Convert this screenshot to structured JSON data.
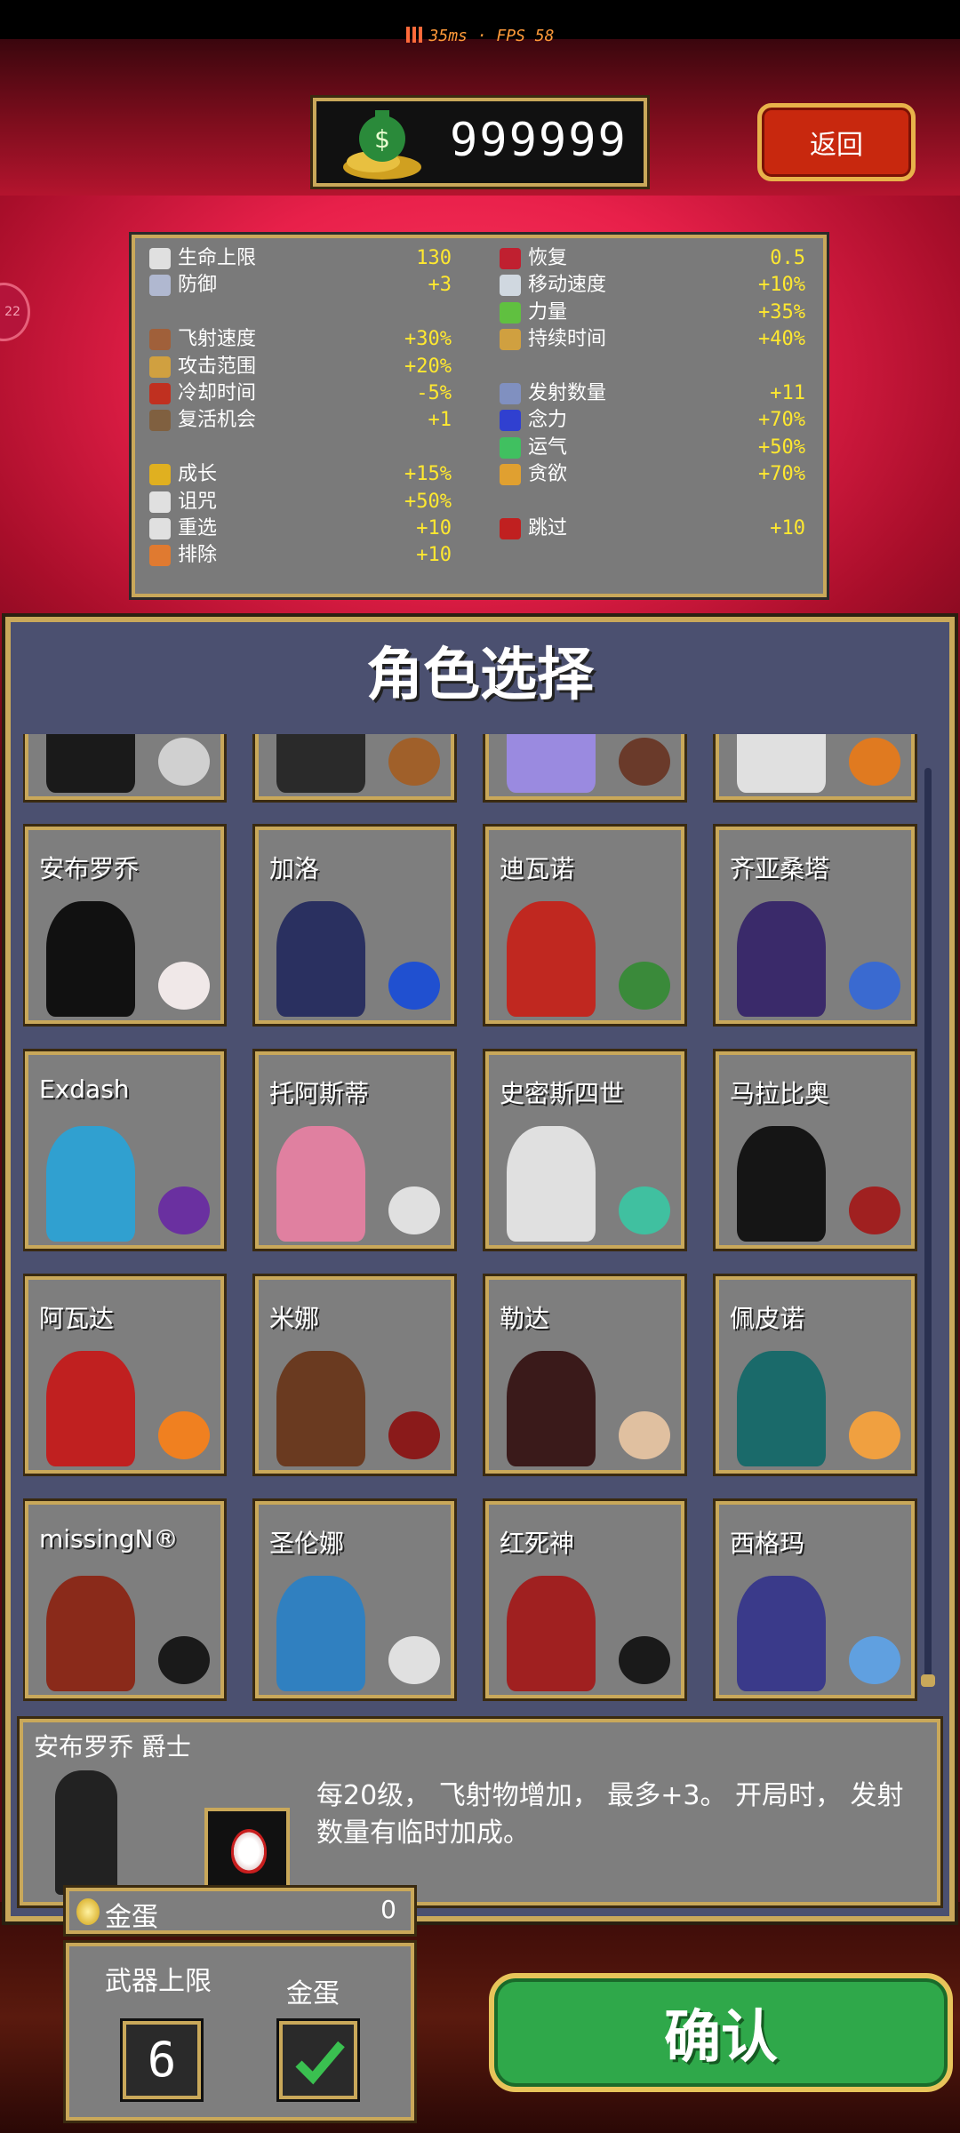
{
  "status": {
    "ping": "35ms",
    "fps": "FPS 58"
  },
  "header": {
    "coins": "999999",
    "back_label": "返回"
  },
  "side_badge": "22",
  "stats_left": [
    {
      "label": "生命上限",
      "value": "130",
      "icon_color": "#e0e0e0"
    },
    {
      "label": "防御",
      "value": "+3",
      "icon_color": "#b0b8d0"
    },
    {
      "label": "飞射速度",
      "value": "+30%",
      "icon_color": "#a0603a"
    },
    {
      "label": "攻击范围",
      "value": "+20%",
      "icon_color": "#d0a040"
    },
    {
      "label": "冷却时间",
      "value": "-5%",
      "icon_color": "#c03020"
    },
    {
      "label": "复活机会",
      "value": "+1",
      "icon_color": "#806040"
    },
    {
      "label": "成长",
      "value": "+15%",
      "icon_color": "#e0b020"
    },
    {
      "label": "诅咒",
      "value": "+50%",
      "icon_color": "#e0e0e0"
    },
    {
      "label": "重选",
      "value": "+10",
      "icon_color": "#e0e0e0"
    },
    {
      "label": "排除",
      "value": "+10",
      "icon_color": "#e07a30"
    }
  ],
  "stats_right": [
    {
      "label": "恢复",
      "value": "0.5",
      "icon_color": "#c02030"
    },
    {
      "label": "移动速度",
      "value": "+10%",
      "icon_color": "#d0d8e0"
    },
    {
      "label": "力量",
      "value": "+35%",
      "icon_color": "#60c040"
    },
    {
      "label": "持续时间",
      "value": "+40%",
      "icon_color": "#d0a040"
    },
    {
      "label": "发射数量",
      "value": "+11",
      "icon_color": "#8090c0"
    },
    {
      "label": "念力",
      "value": "+70%",
      "icon_color": "#3040d0"
    },
    {
      "label": "运气",
      "value": "+50%",
      "icon_color": "#40c060"
    },
    {
      "label": "贪欲",
      "value": "+70%",
      "icon_color": "#e0a030"
    },
    {
      "label": "跳过",
      "value": "+10",
      "icon_color": "#c02020"
    }
  ],
  "panel": {
    "title": "角色选择"
  },
  "characters": [
    {
      "name": "",
      "fig": "#1a1a1a",
      "item": "#d0d0d0"
    },
    {
      "name": "",
      "fig": "#2a2a2a",
      "item": "#a0602a"
    },
    {
      "name": "",
      "fig": "#9a8ae0",
      "item": "#6a3a2a"
    },
    {
      "name": "",
      "fig": "#e0e0e0",
      "item": "#e07a20"
    },
    {
      "name": "安布罗乔",
      "fig": "#111111",
      "item": "#f0e8e8"
    },
    {
      "name": "加洛",
      "fig": "#2a3060",
      "item": "#2050d0"
    },
    {
      "name": "迪瓦诺",
      "fig": "#c02820",
      "item": "#3a8a3a"
    },
    {
      "name": "齐亚桑塔",
      "fig": "#3a2a6a",
      "item": "#3a6ad0"
    },
    {
      "name": "Exdash",
      "fig": "#30a0d0",
      "item": "#6a30a0"
    },
    {
      "name": "托阿斯蒂",
      "fig": "#e080a0",
      "item": "#e0e0e0"
    },
    {
      "name": "史密斯四世",
      "fig": "#e0e0e0",
      "item": "#40c0a0"
    },
    {
      "name": "马拉比奥",
      "fig": "#151515",
      "item": "#a02020"
    },
    {
      "name": "阿瓦达",
      "fig": "#c02020",
      "item": "#f08020"
    },
    {
      "name": "米娜",
      "fig": "#6a3a20",
      "item": "#8a1a1a"
    },
    {
      "name": "勒达",
      "fig": "#3a1a1a",
      "item": "#e0c0a0"
    },
    {
      "name": "佩皮诺",
      "fig": "#1a6a6a",
      "item": "#f0a040"
    },
    {
      "name": "missingN®",
      "fig": "#8a2a1a",
      "item": "#1a1a1a"
    },
    {
      "name": "圣伦娜",
      "fig": "#3080c0",
      "item": "#e0e0e0"
    },
    {
      "name": "红死神",
      "fig": "#a02020",
      "item": "#1a1a1a"
    },
    {
      "name": "西格玛",
      "fig": "#3a3a8a",
      "item": "#60a0e0"
    }
  ],
  "selected": {
    "title": "安布罗乔 爵士",
    "description": "每20级， 飞射物增加， 最多+3。 开局时， 发射数量有临时加成。"
  },
  "golden_egg": {
    "label": "金蛋",
    "count": "0"
  },
  "options": {
    "weapon_limit_label": "武器上限",
    "weapon_limit": "6",
    "egg_label": "金蛋",
    "egg_checked": true
  },
  "confirm_label": "确认",
  "colors": {
    "gold": "#c9a85a",
    "panel": "#4b5070",
    "confirm": "#2fa84a",
    "back": "#c8280e",
    "stat_value": "#ffe830"
  }
}
